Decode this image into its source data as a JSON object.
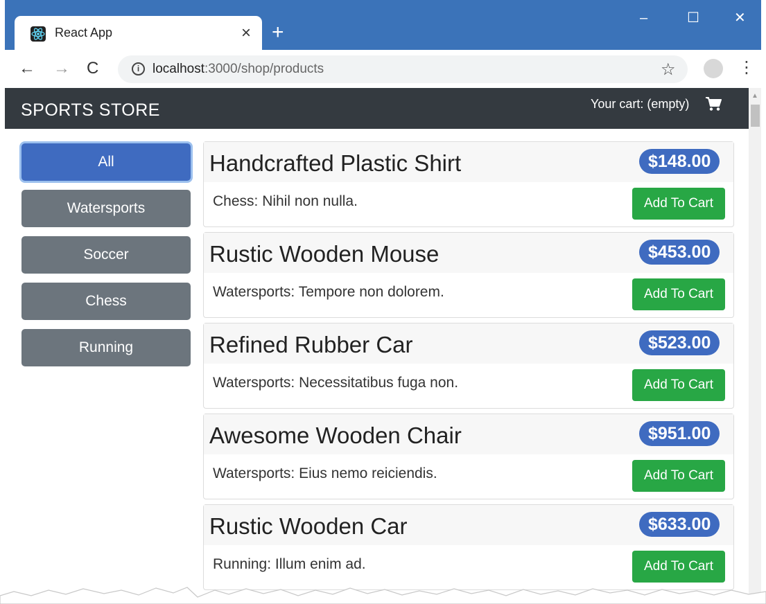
{
  "browser": {
    "tab_title": "React App",
    "tab_close": "×",
    "new_tab": "+",
    "window_controls": {
      "minimize": "–",
      "maximize": "☐",
      "close": "✕"
    },
    "nav": {
      "back": "←",
      "forward": "→",
      "reload": "C"
    },
    "url_host": "localhost",
    "url_path": ":3000/shop/products",
    "star": "☆",
    "menu": "⋮"
  },
  "navbar": {
    "brand": "SPORTS STORE",
    "cart_text": "Your cart: (empty)",
    "cart_icon": "shopping-cart-icon"
  },
  "categories": [
    {
      "label": "All",
      "active": true
    },
    {
      "label": "Watersports",
      "active": false
    },
    {
      "label": "Soccer",
      "active": false
    },
    {
      "label": "Chess",
      "active": false
    },
    {
      "label": "Running",
      "active": false
    }
  ],
  "products": [
    {
      "name": "Handcrafted Plastic Shirt",
      "price": "$148.00",
      "description": "Chess: Nihil non nulla.",
      "button": "Add To Cart"
    },
    {
      "name": "Rustic Wooden Mouse",
      "price": "$453.00",
      "description": "Watersports: Tempore non dolorem.",
      "button": "Add To Cart"
    },
    {
      "name": "Refined Rubber Car",
      "price": "$523.00",
      "description": "Watersports: Necessitatibus fuga non.",
      "button": "Add To Cart"
    },
    {
      "name": "Awesome Wooden Chair",
      "price": "$951.00",
      "description": "Watersports: Eius nemo reiciendis.",
      "button": "Add To Cart"
    },
    {
      "name": "Rustic Wooden Car",
      "price": "$633.00",
      "description": "Running: Illum enim ad.",
      "button": "Add To Cart"
    }
  ],
  "colors": {
    "titlebar": "#3b73b9",
    "navbar": "#343a40",
    "primary": "#3f6bc0",
    "secondary": "#6c757d",
    "success": "#28a745"
  }
}
